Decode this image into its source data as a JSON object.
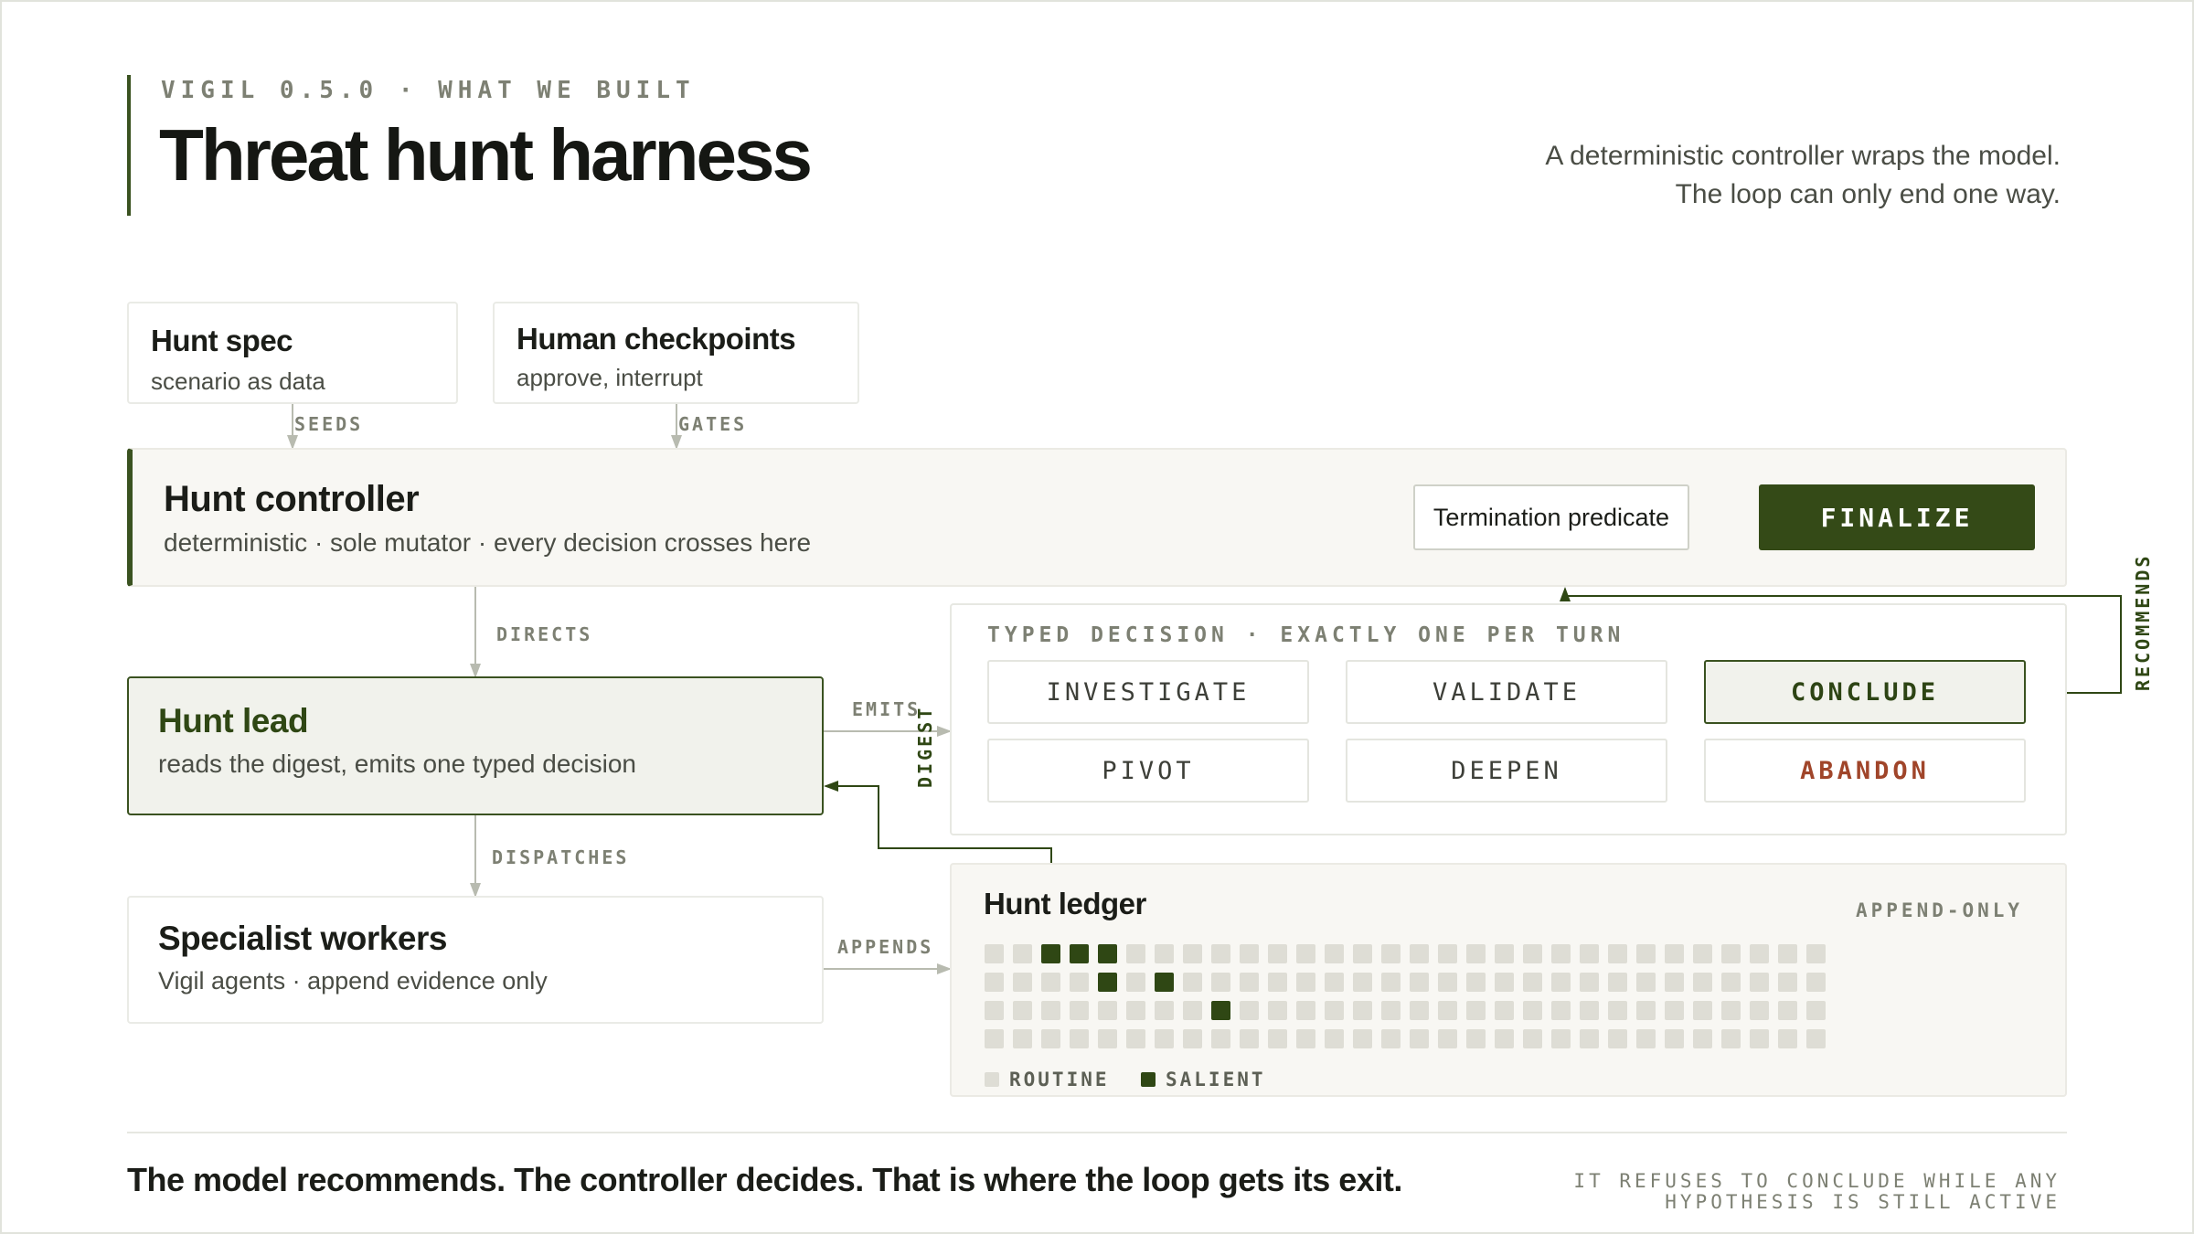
{
  "header": {
    "kicker": "VIGIL 0.5.0 · WHAT WE BUILT",
    "title": "Threat hunt harness",
    "lede": "A deterministic controller wraps the model. The loop can only end one way."
  },
  "inputs": {
    "spec": {
      "title": "Hunt spec",
      "subtitle": "scenario as data",
      "edge": "SEEDS"
    },
    "checkpoints": {
      "title": "Human checkpoints",
      "subtitle": "approve, interrupt",
      "edge": "GATES"
    }
  },
  "controller": {
    "title": "Hunt controller",
    "subtitle": "deterministic · sole mutator · every decision crosses here",
    "predicate": "Termination predicate",
    "finalize": "FINALIZE"
  },
  "lead": {
    "title": "Hunt lead",
    "subtitle": "reads the digest, emits one typed decision"
  },
  "workers": {
    "title": "Specialist workers",
    "subtitle": "Vigil agents · append evidence only"
  },
  "edges": {
    "directs": "DIRECTS",
    "emits": "EMITS",
    "digest": "DIGEST",
    "dispatches": "DISPATCHES",
    "appends": "APPENDS",
    "recommends": "RECOMMENDS"
  },
  "decisions": {
    "title": "TYPED DECISION · EXACTLY ONE PER TURN",
    "items": [
      "INVESTIGATE",
      "VALIDATE",
      "CONCLUDE",
      "PIVOT",
      "DEEPEN",
      "ABANDON"
    ],
    "highlighted": "CONCLUDE",
    "warning": "ABANDON"
  },
  "ledger": {
    "title": "Hunt ledger",
    "tag": "APPEND-ONLY",
    "columns": 30,
    "rows": 4,
    "salient": [
      [
        0,
        2
      ],
      [
        0,
        3
      ],
      [
        0,
        4
      ],
      [
        1,
        4
      ],
      [
        1,
        6
      ],
      [
        2,
        8
      ]
    ],
    "legend": {
      "routine": "ROUTINE",
      "salient": "SALIENT"
    }
  },
  "footer": {
    "statement": "The model recommends. The controller decides. That is where the loop gets its exit.",
    "note": "IT REFUSES TO CONCLUDE WHILE ANY HYPOTHESIS IS STILL ACTIVE"
  },
  "colors": {
    "accent": "#3a5220",
    "salient": "#2f4714",
    "routine": "#deddd5",
    "warning": "#a0452a"
  }
}
